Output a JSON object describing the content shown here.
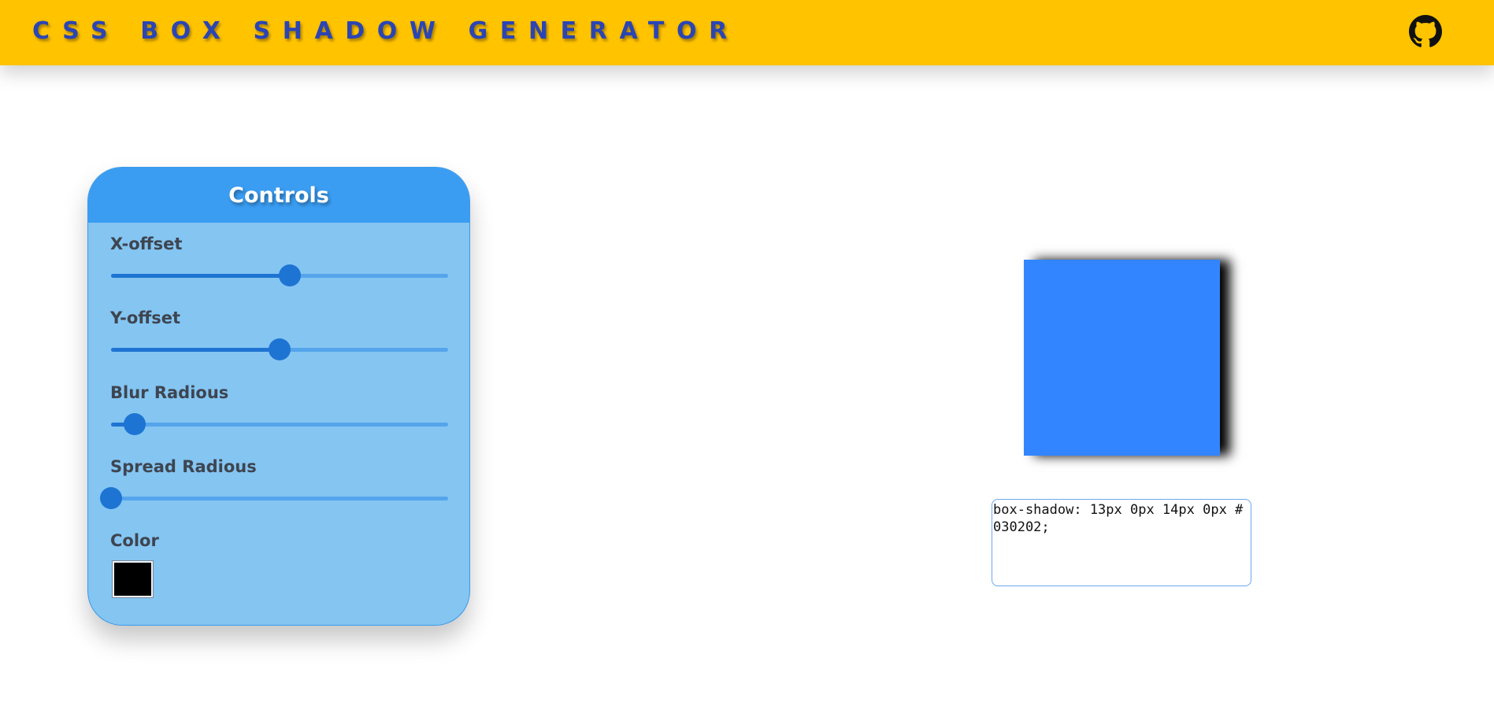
{
  "header": {
    "title": "CSS BOX SHADOW GENERATOR",
    "github_icon": "github-icon",
    "background_color": "#ffc300",
    "title_color": "#2b45b3"
  },
  "controls": {
    "title": "Controls",
    "sliders": [
      {
        "label": "X-offset",
        "fraction": 0.53
      },
      {
        "label": "Y-offset",
        "fraction": 0.5
      },
      {
        "label": "Blur Radious",
        "fraction": 0.07
      },
      {
        "label": "Spread Radious",
        "fraction": 0.0
      }
    ],
    "color_label": "Color",
    "color_value": "#000000"
  },
  "preview": {
    "box_color": "#3385ff",
    "css_output": "box-shadow: 13px 0px 14px 0px #030202;"
  }
}
